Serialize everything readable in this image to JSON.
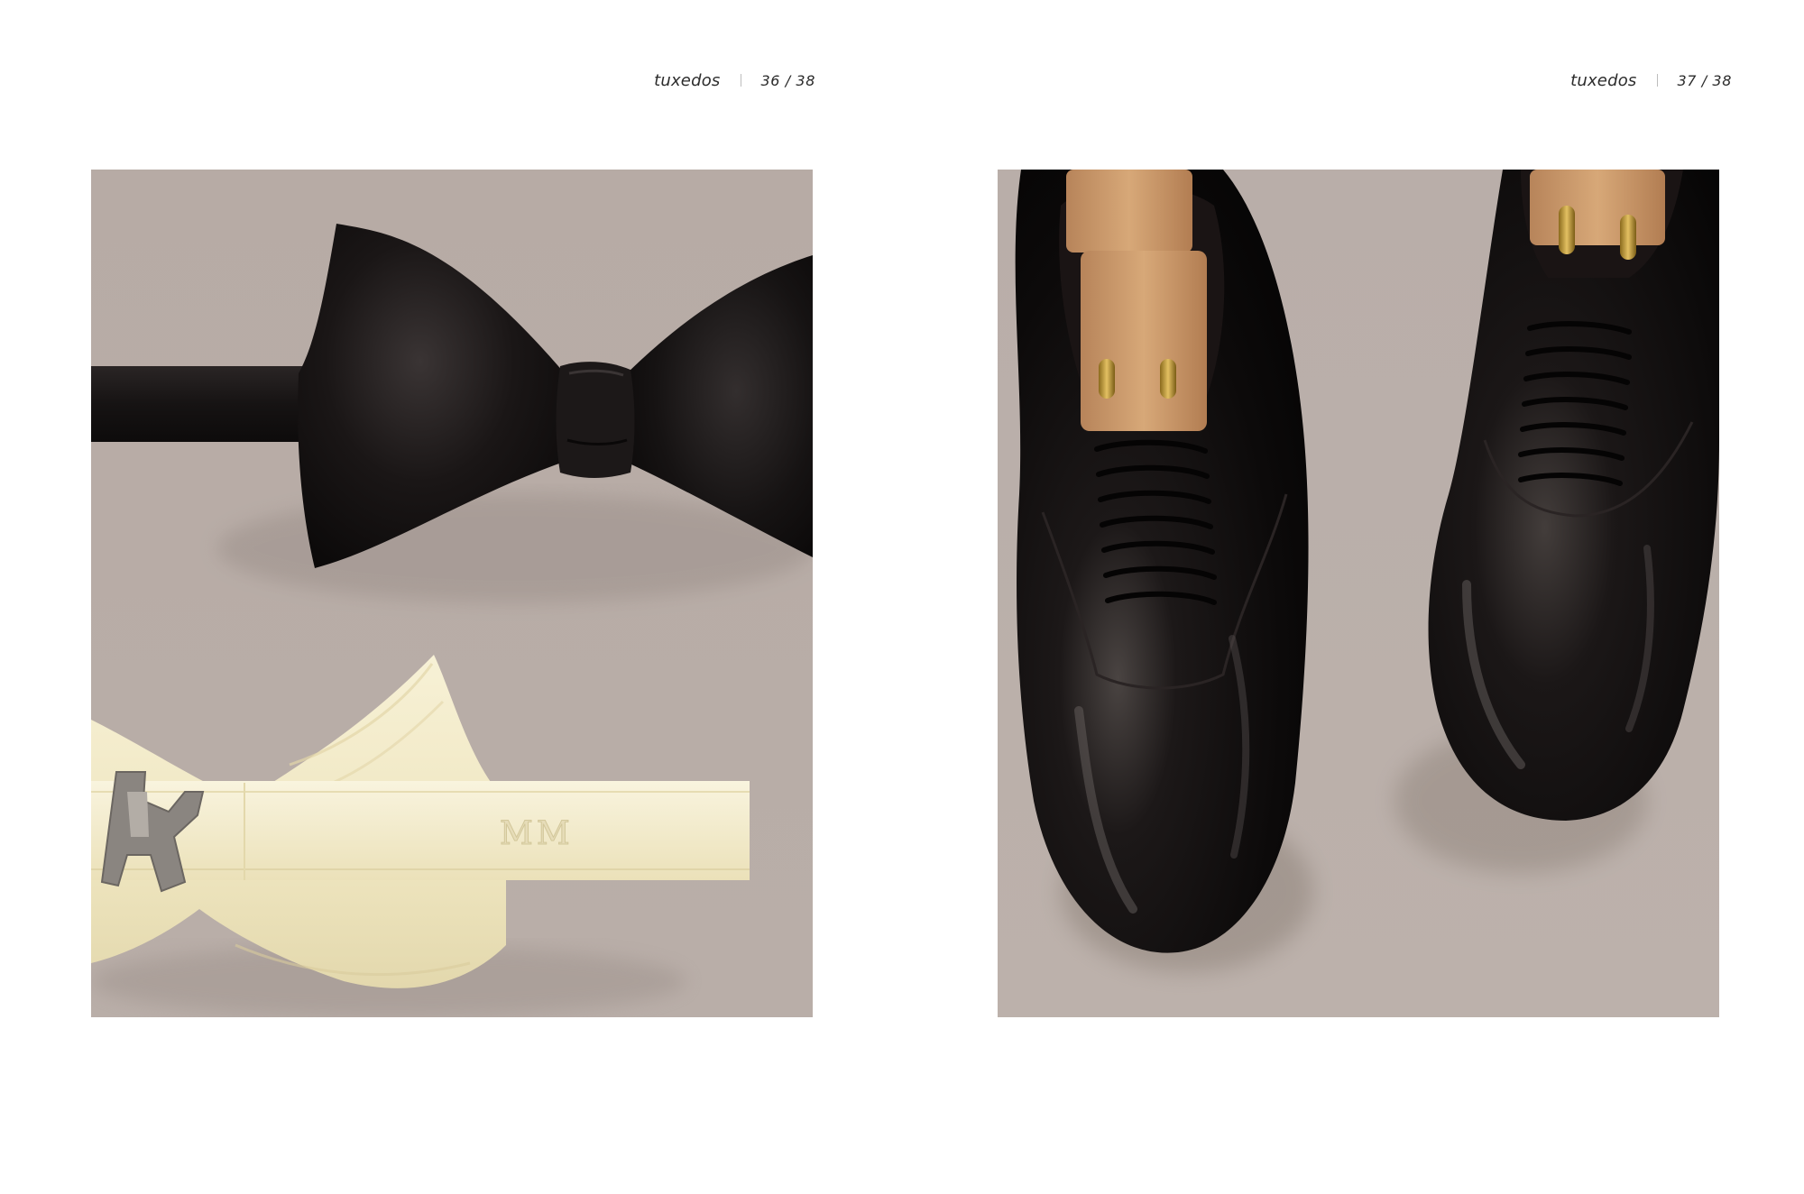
{
  "spread": {
    "left_page": {
      "section": "tuxedos",
      "page_number": "36 / 38",
      "photo": {
        "subject": "bow ties",
        "monogram": "MM",
        "background_color": "#b8aca6",
        "black_tie_color": "#141111",
        "ivory_tie_color": "#f3ecc8"
      }
    },
    "right_page": {
      "section": "tuxedos",
      "page_number": "37 / 38",
      "photo": {
        "subject": "patent leather oxford shoes",
        "background_color": "#b9aea8",
        "shoe_color": "#0e0b0a",
        "shoe_tree_color": "#c99a6a"
      }
    }
  }
}
